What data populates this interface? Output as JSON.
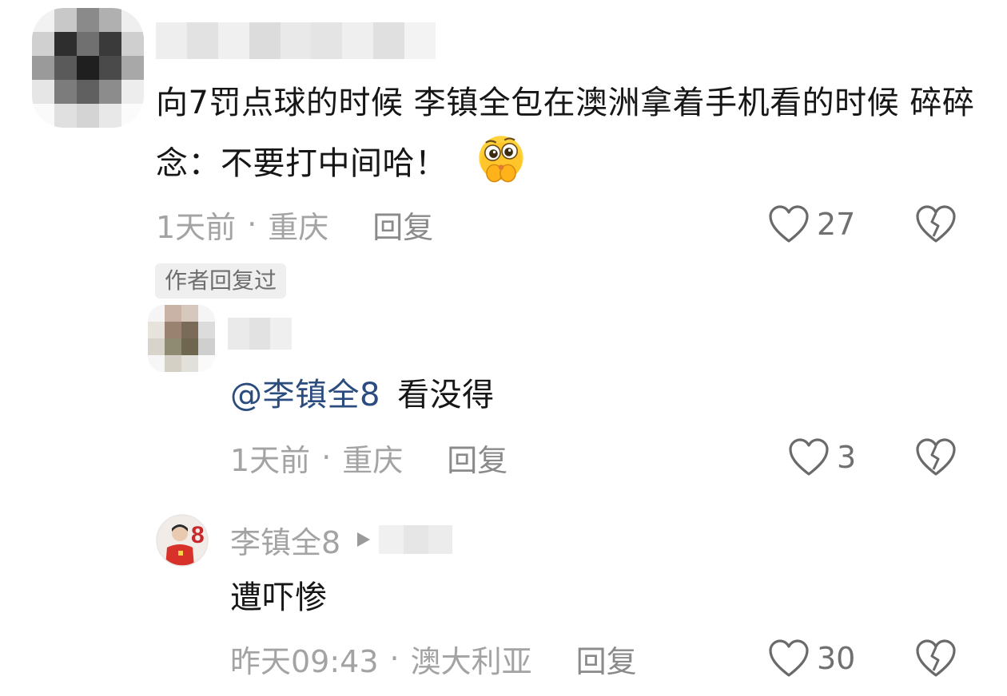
{
  "comment": {
    "text": "向7罚点球的时候  李镇全包在澳洲拿着手机看的时候 碎碎念：不要打中间哈！",
    "emoji": "pleading-hands-emoji",
    "time": "1天前",
    "location": "重庆",
    "reply_label": "回复",
    "likes": "27",
    "author_badge": "作者回复过"
  },
  "reply1": {
    "mention": "@李镇全8",
    "text": " 看没得",
    "time": "1天前",
    "location": "重庆",
    "reply_label": "回复",
    "likes": "3"
  },
  "reply2": {
    "username": "李镇全8",
    "text": "遭吓惨",
    "time": "昨天09:43",
    "location": "澳大利亚",
    "reply_label": "回复",
    "likes": "30"
  },
  "separator": "·",
  "colors": {
    "mention": "#2b4c7e",
    "meta": "#a3a3a3",
    "avatar_jersey": "#d8312a"
  }
}
